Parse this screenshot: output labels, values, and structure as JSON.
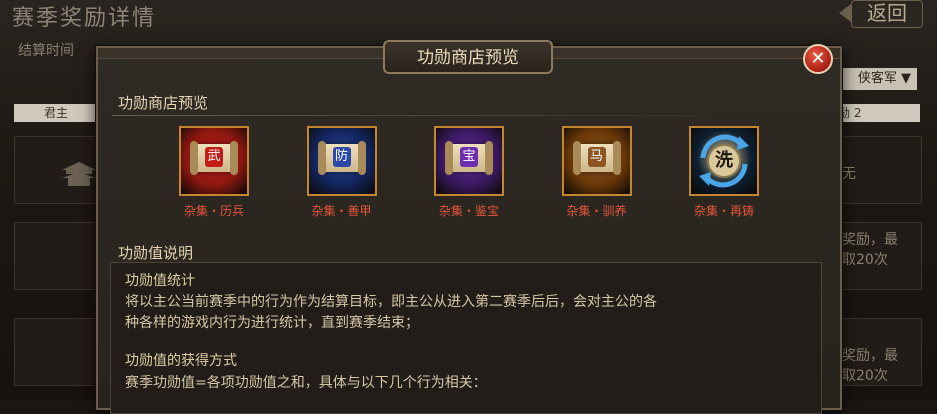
{
  "background": {
    "title": "赛季奖励详情",
    "back_label": "返回",
    "settle_label": "结算时间",
    "dropdown_value": "侠客军",
    "left_bar": "君主",
    "right_bar": "励 2",
    "side_text_1": "无",
    "side_text_2a": "奖励，最",
    "side_text_2b": "取20次",
    "side_text_3a": "奖励，最",
    "side_text_3b": "取20次"
  },
  "modal": {
    "title": "功勋商店预览",
    "close_icon": "close-icon",
    "shop_section_title": "功勋商店预览",
    "items": [
      {
        "label": "杂集・历兵",
        "char": "武",
        "icon": "scroll-icon",
        "bg": "#8e1810",
        "char_bg": "#c21c16"
      },
      {
        "label": "杂集・善甲",
        "char": "防",
        "icon": "scroll-icon",
        "bg": "#12255e",
        "char_bg": "#2c48a8"
      },
      {
        "label": "杂集・鉴宝",
        "char": "宝",
        "icon": "scroll-icon",
        "bg": "#3a1960",
        "char_bg": "#6d2fb0"
      },
      {
        "label": "杂集・驯养",
        "char": "马",
        "icon": "scroll-icon",
        "bg": "#6a3808",
        "char_bg": "#8c5522"
      },
      {
        "label": "杂集・再铸",
        "char": "洗",
        "icon": "refresh-icon",
        "bg": "#0e1f30",
        "char_bg": "#d9c99a"
      }
    ],
    "desc_section_title": "功勋值说明",
    "desc_lines": [
      "功勋值统计",
      "将以主公当前赛季中的行为作为结算目标，即主公从进入第二赛季后后，会对主公的各",
      "种各样的游戏内行为进行统计，直到赛季结束；",
      "",
      "功勋值的获得方式",
      "赛季功勋值=各项功勋值之和，具体与以下几个行为相关："
    ]
  }
}
